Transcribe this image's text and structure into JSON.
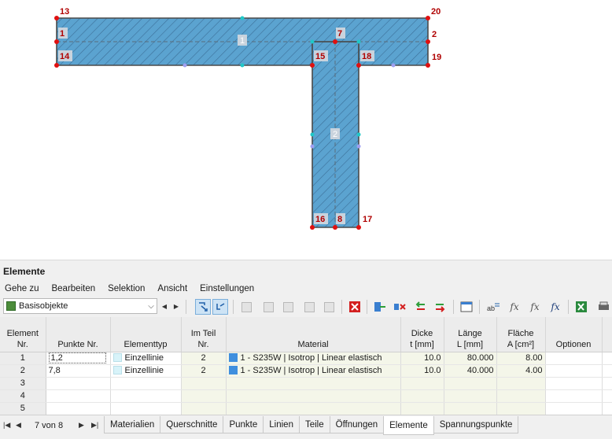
{
  "drawing": {
    "node_labels": [
      "13",
      "20",
      "2",
      "1",
      "7",
      "15",
      "18",
      "14",
      "19",
      "16",
      "8",
      "17"
    ],
    "part_labels": [
      "1",
      "2"
    ]
  },
  "panel": {
    "title": "Elemente",
    "menu": [
      "Gehe zu",
      "Bearbeiten",
      "Selektion",
      "Ansicht",
      "Einstellungen"
    ]
  },
  "toolbar": {
    "combo_value": "Basisobjekte"
  },
  "table": {
    "headers": {
      "element_nr": [
        "Element",
        "Nr."
      ],
      "punkte": "Punkte Nr.",
      "elementtyp": "Elementtyp",
      "im_teil": [
        "Im Teil",
        "Nr."
      ],
      "material": "Material",
      "dicke": [
        "Dicke",
        "t [mm]"
      ],
      "laenge": [
        "Länge",
        "L [mm]"
      ],
      "flaeche": [
        "Fläche",
        "A [cm²]"
      ],
      "optionen": "Optionen"
    },
    "rows": [
      {
        "nr": "1",
        "punkte": "1,2",
        "typ": "Einzellinie",
        "teil": "2",
        "material": "1 - S235W | Isotrop | Linear elastisch",
        "dicke": "10.0",
        "laenge": "80.000",
        "flaeche": "8.00",
        "optionen": ""
      },
      {
        "nr": "2",
        "punkte": "7,8",
        "typ": "Einzellinie",
        "teil": "2",
        "material": "1 - S235W | Isotrop | Linear elastisch",
        "dicke": "10.0",
        "laenge": "40.000",
        "flaeche": "4.00",
        "optionen": ""
      },
      {
        "nr": "3"
      },
      {
        "nr": "4"
      },
      {
        "nr": "5"
      }
    ]
  },
  "status": {
    "page_info": "7 von 8",
    "tabs": [
      "Materialien",
      "Querschnitte",
      "Punkte",
      "Linien",
      "Teile",
      "Öffnungen",
      "Elemente",
      "Spannungspunkte"
    ],
    "active_tab": "Elemente"
  },
  "colors": {
    "section_fill": "#5ba3d0",
    "node_red": "#e01010",
    "node_cyan": "#20c8c8",
    "node_violet": "#9f9ff0",
    "accent_blue": "#3f8fde"
  }
}
